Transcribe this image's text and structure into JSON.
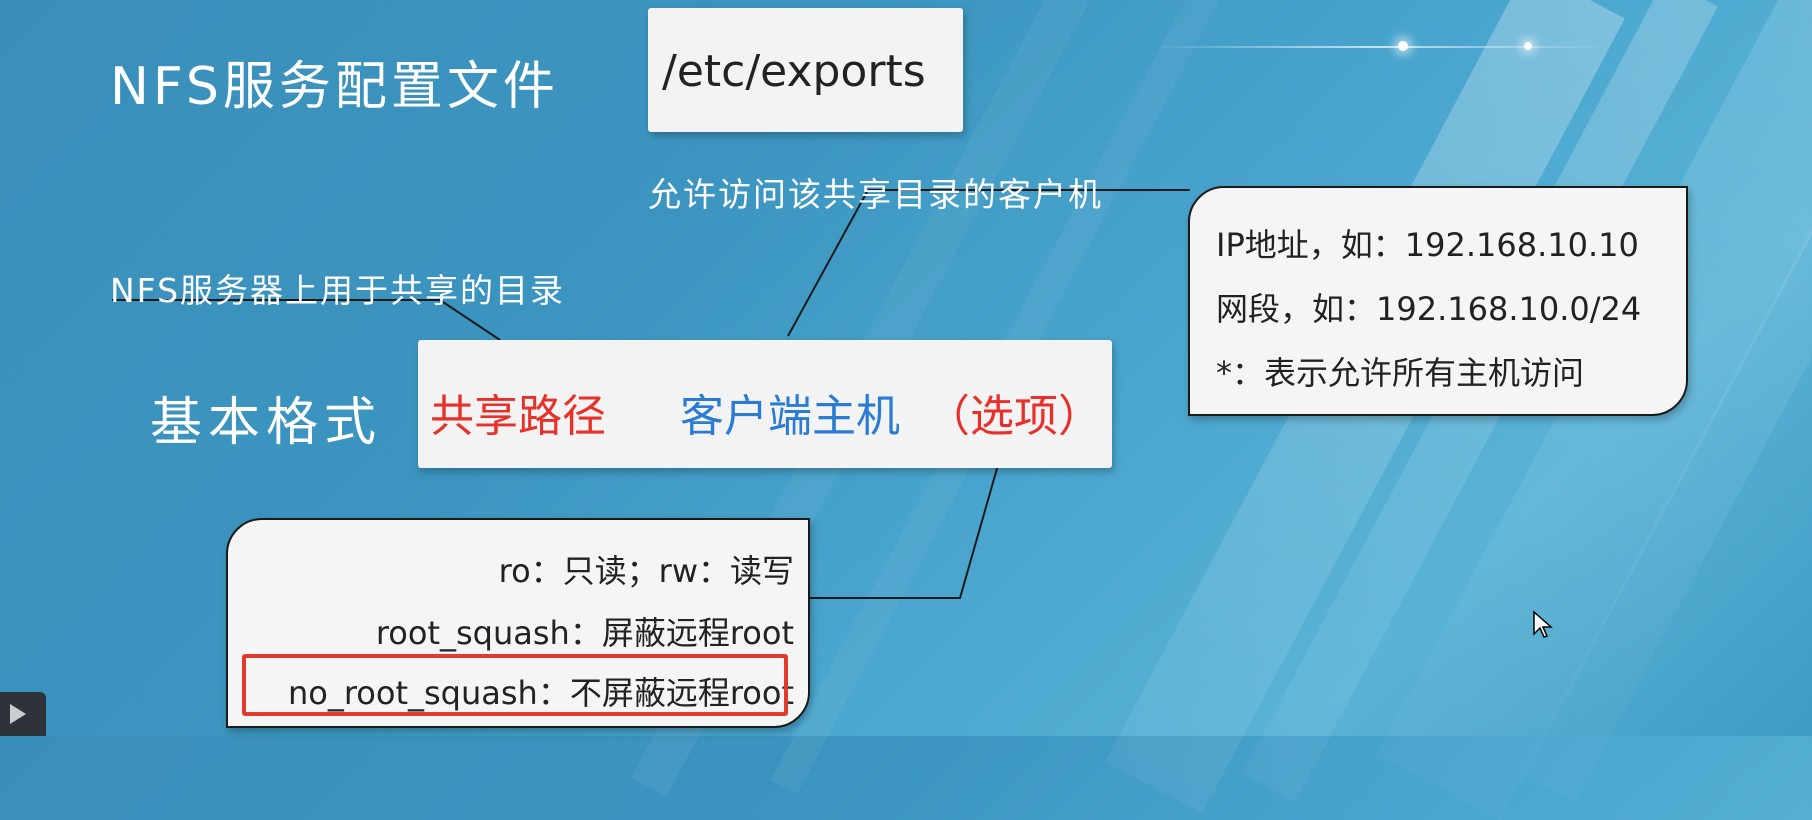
{
  "slide": {
    "title": "NFS服务配置文件",
    "file_path": "/etc/exports",
    "client_note": "允许访问该共享目录的客户机",
    "path_note": "NFS服务器上用于共享的目录",
    "basic_format_label": "基本格式",
    "format": {
      "share_path": "共享路径",
      "client_host": "客户端主机",
      "options": "（选项）"
    },
    "client_examples": [
      "IP地址，如：192.168.10.10",
      "网段，如：192.168.10.0/24",
      "*：表示允许所有主机访问"
    ],
    "option_examples": [
      "ro：只读；rw：读写",
      "root_squash：屏蔽远程root",
      "no_root_squash：不屏蔽远程root"
    ]
  },
  "colors": {
    "share_path": "#e8302a",
    "client_host": "#2a7bd2",
    "options": "#e8302a",
    "highlight": "#e23b2b"
  },
  "icons": {
    "cursor": "mouse-pointer-icon",
    "play": "play-icon"
  }
}
